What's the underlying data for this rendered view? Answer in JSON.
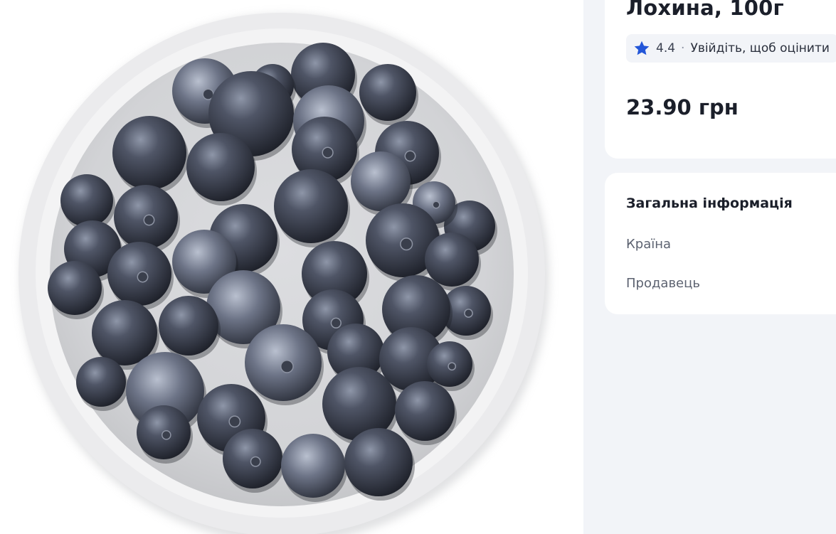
{
  "product": {
    "title": "Лохина, 100г",
    "image_subject": "blueberries-in-bowl",
    "rating": {
      "value": "4.4",
      "separator": "·",
      "login_prompt": "Увійдіть, щоб оцінити",
      "star_color": "#2356d8"
    },
    "price": "23.90 грн"
  },
  "general_info": {
    "title": "Загальна інформація",
    "rows": [
      {
        "label": "Країна"
      },
      {
        "label": "Продавець"
      }
    ]
  },
  "colors": {
    "sidebar_bg": "#f2f4f8",
    "card_bg": "#ffffff",
    "accent": "#2356d8"
  }
}
